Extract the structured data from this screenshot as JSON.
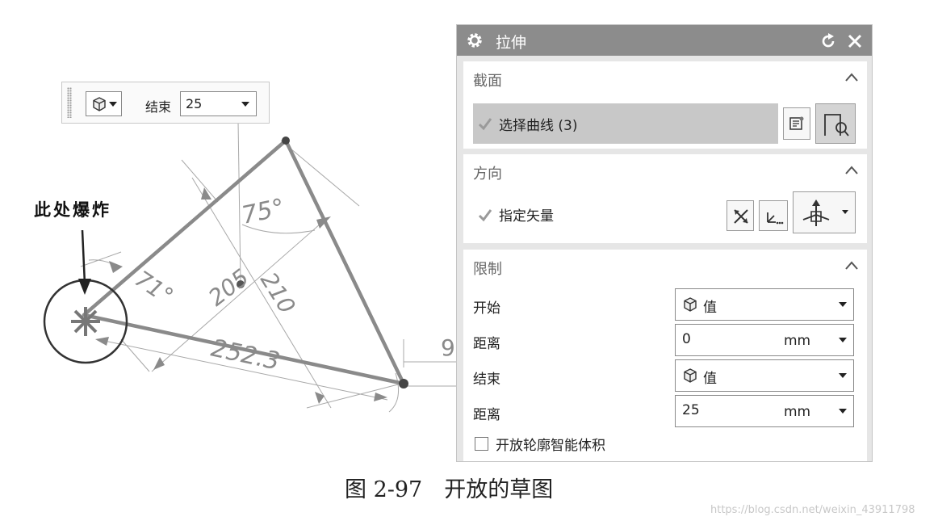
{
  "sketch": {
    "annotation": "此处爆炸",
    "dimensions": {
      "angle_top": "75°",
      "angle_left": "71°",
      "d1": "205",
      "d2": "210",
      "d3": "252.3",
      "edge": "9"
    }
  },
  "mini_toolbar": {
    "end_label": "结束",
    "end_value": "25"
  },
  "dialog": {
    "title": "拉伸",
    "section_section": {
      "title": "截面",
      "select_curve": "选择曲线 (3)"
    },
    "section_direction": {
      "title": "方向",
      "specify_vector": "指定矢量"
    },
    "section_limits": {
      "title": "限制",
      "start_label": "开始",
      "start_value": "值",
      "start_dist_label": "距离",
      "start_dist_value": "0",
      "start_dist_unit": "mm",
      "end_label": "结束",
      "end_value": "值",
      "end_dist_label": "距离",
      "end_dist_value": "25",
      "end_dist_unit": "mm",
      "open_profile_label": "开放轮廓智能体积"
    }
  },
  "caption": "图 2-97　开放的草图",
  "watermark": "https://blog.csdn.net/weixin_43911798",
  "colors": {
    "titlebar": "#8c8c8c",
    "dialog_bg": "#e6e6e6",
    "selected_row": "#c8c8c8",
    "sketch_line": "#8a8a8a"
  }
}
